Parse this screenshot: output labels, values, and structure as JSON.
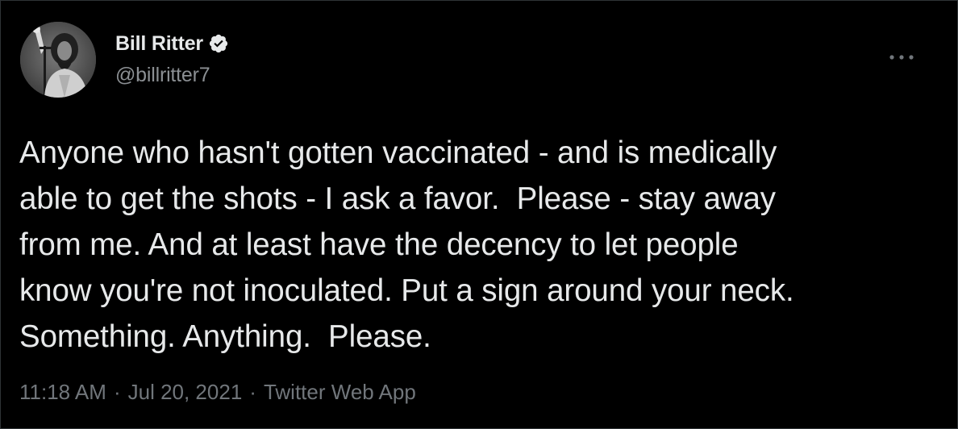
{
  "author": {
    "display_name": "Bill Ritter",
    "handle": "@billritter7",
    "verified": true
  },
  "tweet": {
    "text": "Anyone who hasn't gotten vaccinated - and is medically\nable to get the shots - I ask a favor.  Please - stay away\nfrom me. And at least have the decency to let people\nknow you're not inoculated. Put a sign around your neck.\nSomething. Anything.  Please."
  },
  "meta": {
    "time": "11:18 AM",
    "separator": "·",
    "date": "Jul 20, 2021",
    "source": "Twitter Web App"
  },
  "icons": {
    "verified": "verified-badge-icon",
    "more": "more-options-icon"
  },
  "colors": {
    "background": "#000000",
    "text": "#e7e9ea",
    "secondary": "#71767b",
    "border": "#2f3336"
  }
}
